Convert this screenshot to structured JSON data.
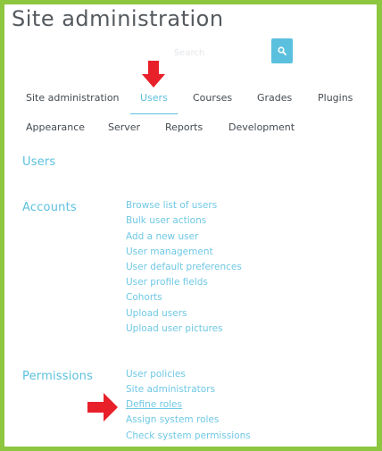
{
  "page": {
    "title": "Site administration"
  },
  "search": {
    "placeholder": "Search",
    "button_icon": "search-icon",
    "button_color": "#5bc0de"
  },
  "tabs": {
    "row1": [
      {
        "label": "Site administration"
      },
      {
        "label": "Users",
        "active": true
      },
      {
        "label": "Courses"
      },
      {
        "label": "Grades"
      },
      {
        "label": "Plugins"
      }
    ],
    "row2": [
      {
        "label": "Appearance"
      },
      {
        "label": "Server"
      },
      {
        "label": "Reports"
      },
      {
        "label": "Development"
      }
    ]
  },
  "users_section": {
    "heading": "Users"
  },
  "accounts": {
    "heading": "Accounts",
    "links": [
      "Browse list of users",
      "Bulk user actions",
      "Add a new user",
      "User management",
      "User default preferences",
      "User profile fields",
      "Cohorts",
      "Upload users",
      "Upload user pictures"
    ]
  },
  "permissions": {
    "heading": "Permissions",
    "links": [
      "User policies",
      "Site administrators",
      "Define roles",
      "Assign system roles",
      "Check system permissions"
    ]
  },
  "colors": {
    "frame": "#8dc63f",
    "accent": "#5bc0de",
    "link": "#6fc8e4",
    "annotation_arrow": "#e8202a"
  },
  "annotations": [
    {
      "icon": "down-arrow-icon",
      "points_to": "Users"
    },
    {
      "icon": "right-arrow-icon",
      "points_to": "Define roles"
    }
  ]
}
